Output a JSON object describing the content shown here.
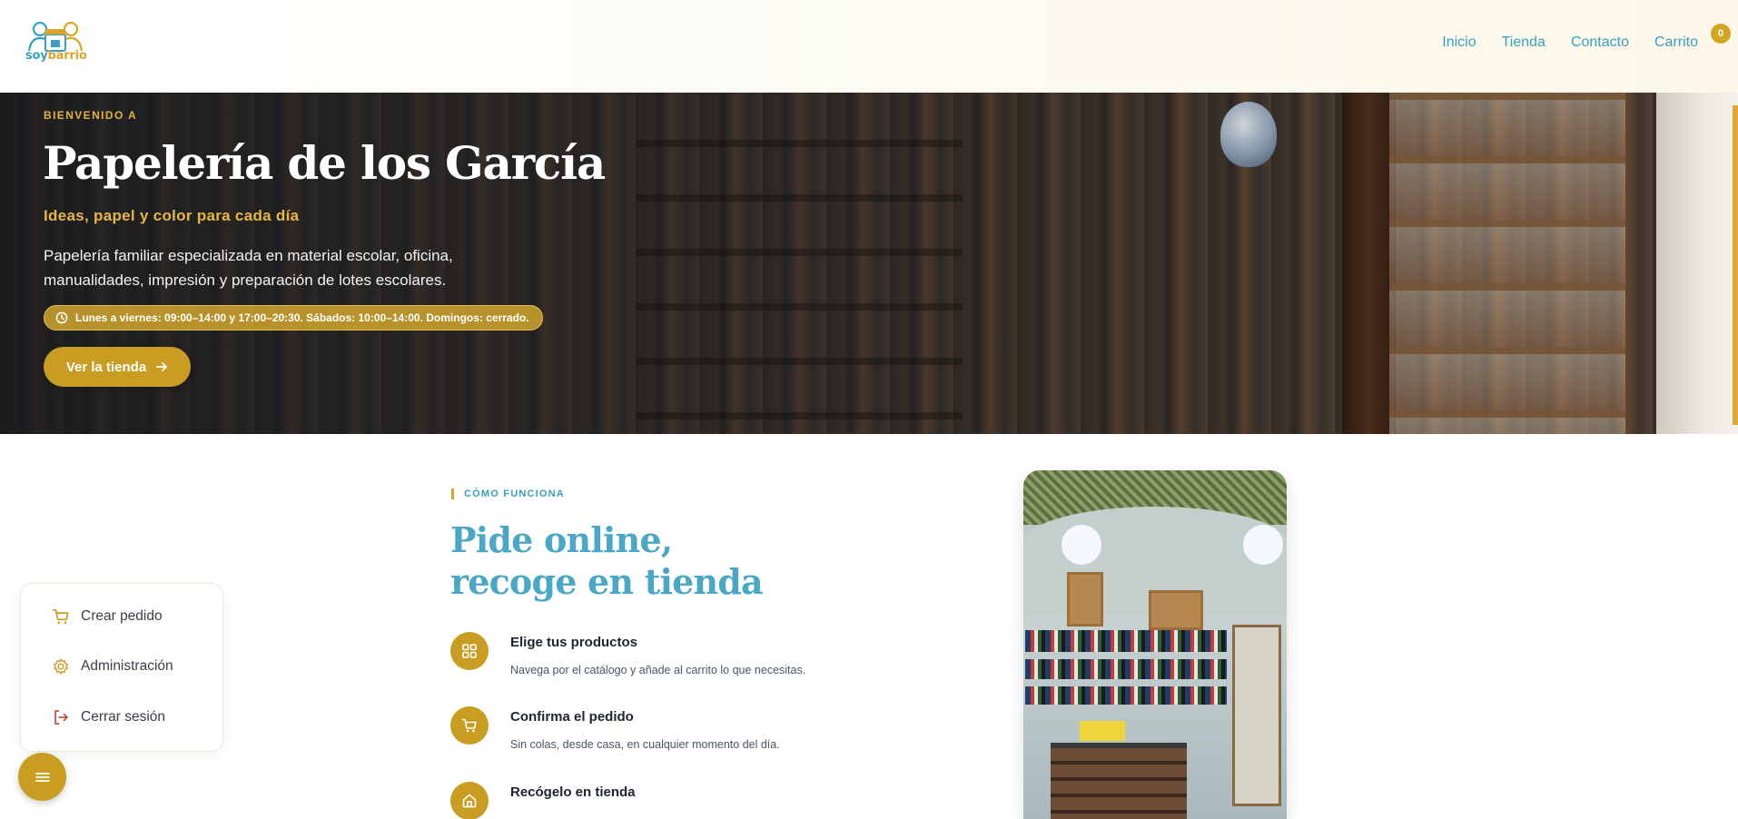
{
  "brand": {
    "logo_part1": "soy",
    "logo_part2": "barrio",
    "primary": "#3a9fc0",
    "accent": "#c99d22"
  },
  "nav": {
    "items": [
      "Inicio",
      "Tienda",
      "Contacto",
      "Carrito"
    ],
    "cart_count": "0"
  },
  "hero": {
    "eyebrow": "BIENVENIDO A",
    "title": "Papelería de los García",
    "subtitle": "Ideas, papel y color para cada día",
    "description": "Papelería familiar especializada en material escolar, oficina, manualidades, impresión y preparación de lotes escolares.",
    "hours": "Lunes a viernes: 09:00–14:00 y 17:00–20:30. Sábados: 10:00–14:00. Domingos: cerrado.",
    "cta_label": "Ver la tienda",
    "hours_icon": "clock-icon",
    "cta_icon": "arrow-right-icon"
  },
  "how": {
    "eyebrow": "CÓMO FUNCIONA",
    "title_line1": "Pide online,",
    "title_line2": "recoge en tienda",
    "steps": [
      {
        "icon": "grid-icon",
        "title": "Elige tus productos",
        "desc": "Navega por el catálogo y añade al carrito lo que necesitas."
      },
      {
        "icon": "cart-icon",
        "title": "Confirma el pedido",
        "desc": "Sin colas, desde casa, en cualquier momento del día."
      },
      {
        "icon": "home-icon",
        "title": "Recógelo en tienda",
        "desc": ""
      }
    ]
  },
  "float_menu": {
    "items": [
      {
        "icon": "cart-icon",
        "label": "Crear pedido"
      },
      {
        "icon": "gear-icon",
        "label": "Administración"
      },
      {
        "icon": "logout-icon",
        "label": "Cerrar sesión"
      }
    ],
    "toggle_icon": "menu-icon"
  }
}
